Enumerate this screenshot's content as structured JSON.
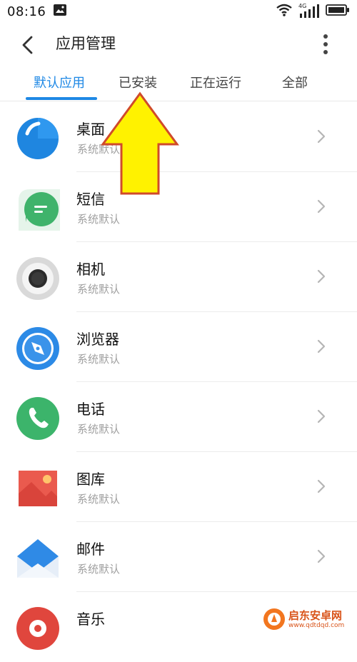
{
  "status_bar": {
    "time": "08:16",
    "network_label": "4G",
    "icons": [
      "gallery-notification-icon",
      "wifi-icon",
      "signal-icon",
      "battery-icon"
    ]
  },
  "header": {
    "title": "应用管理",
    "back_icon": "chevron-left-icon",
    "more_icon": "more-vertical-icon"
  },
  "tabs": [
    {
      "label": "默认应用",
      "active": true
    },
    {
      "label": "已安装",
      "active": false
    },
    {
      "label": "正在运行",
      "active": false
    },
    {
      "label": "全部",
      "active": false
    }
  ],
  "apps": [
    {
      "name": "桌面",
      "subtitle": "系统默认",
      "icon": "launcher-icon"
    },
    {
      "name": "短信",
      "subtitle": "系统默认",
      "icon": "messages-icon"
    },
    {
      "name": "相机",
      "subtitle": "系统默认",
      "icon": "camera-icon"
    },
    {
      "name": "浏览器",
      "subtitle": "系统默认",
      "icon": "browser-icon"
    },
    {
      "name": "电话",
      "subtitle": "系统默认",
      "icon": "phone-icon"
    },
    {
      "name": "图库",
      "subtitle": "系统默认",
      "icon": "gallery-icon"
    },
    {
      "name": "邮件",
      "subtitle": "系统默认",
      "icon": "mail-icon"
    },
    {
      "name": "音乐",
      "subtitle": "",
      "icon": "music-icon"
    }
  ],
  "colors": {
    "accent": "#1e88e5",
    "arrow_fill": "#fff200",
    "arrow_stroke": "#d04a2a"
  },
  "watermark": {
    "title": "启东安卓网",
    "url": "www.qdtdqd.com"
  }
}
